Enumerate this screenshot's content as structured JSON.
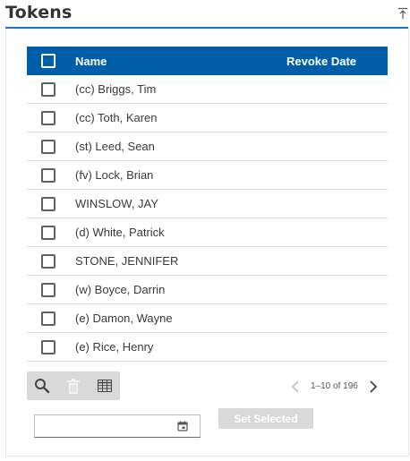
{
  "panel": {
    "title": "Tokens"
  },
  "table": {
    "columns": {
      "name": "Name",
      "revoke_date": "Revoke Date"
    },
    "rows": [
      {
        "name": "(cc) Briggs, Tim",
        "revoke_date": ""
      },
      {
        "name": "(cc) Toth, Karen",
        "revoke_date": ""
      },
      {
        "name": "(st) Leed, Sean",
        "revoke_date": ""
      },
      {
        "name": "(fv) Lock, Brian",
        "revoke_date": ""
      },
      {
        "name": "WINSLOW, JAY",
        "revoke_date": ""
      },
      {
        "name": "(d) White, Patrick",
        "revoke_date": ""
      },
      {
        "name": "STONE, JENNIFER",
        "revoke_date": ""
      },
      {
        "name": "(w) Boyce, Darrin",
        "revoke_date": ""
      },
      {
        "name": "(e) Damon, Wayne",
        "revoke_date": ""
      },
      {
        "name": "(e) Rice, Henry",
        "revoke_date": ""
      }
    ]
  },
  "toolbar": {
    "icons": [
      "search-icon",
      "trash-icon",
      "columns-icon"
    ]
  },
  "pagination": {
    "label": "1–10 of 196"
  },
  "form": {
    "date_value": "",
    "set_selected_label": "Set Selected"
  },
  "colors": {
    "header_bg": "#005ea8",
    "accent_rule": "#1a73c8",
    "disabled_button": "#d9d9d9"
  }
}
